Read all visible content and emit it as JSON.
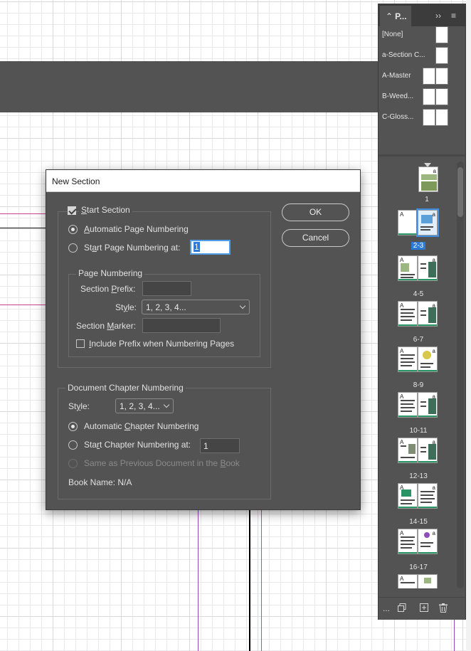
{
  "dialog": {
    "title": "New Section",
    "start_section": {
      "label_pre": "",
      "label_u": "S",
      "label_post": "tart Section",
      "checked": true
    },
    "auto_page_numbering": {
      "label_pre": "",
      "label_u": "A",
      "label_post": "utomatic Page Numbering",
      "selected": true
    },
    "start_page_numbering": {
      "label_pre": "St",
      "label_u": "a",
      "label_post": "rt Page Numbering at:",
      "selected": false,
      "value": "1"
    },
    "page_numbering_group": {
      "title": "Page Numbering",
      "section_prefix_label_pre": "Section ",
      "section_prefix_label_u": "P",
      "section_prefix_label_post": "refix:",
      "section_prefix_value": "",
      "style_label_pre": "St",
      "style_label_u": "y",
      "style_label_post": "le:",
      "style_value": "1, 2, 3, 4...",
      "section_marker_label_pre": "Section ",
      "section_marker_label_u": "M",
      "section_marker_label_post": "arker:",
      "section_marker_value": "",
      "include_prefix_label_pre": "",
      "include_prefix_label_u": "I",
      "include_prefix_label_post": "nclude Prefix when Numbering Pages",
      "include_prefix_checked": false
    },
    "chapter_group": {
      "title": "Document Chapter Numbering",
      "style_label_pre": "St",
      "style_label_u": "y",
      "style_label_post": "le:",
      "style_value": "1, 2, 3, 4...",
      "auto_chapter_pre": "Automatic ",
      "auto_chapter_u": "C",
      "auto_chapter_post": "hapter Numbering",
      "auto_chapter_selected": true,
      "start_chapter_pre": "Sta",
      "start_chapter_u": "r",
      "start_chapter_post": "t Chapter Numbering at:",
      "start_chapter_value": "1",
      "same_as_prev_pre": "Same as Previous Document in the ",
      "same_as_prev_u": "B",
      "same_as_prev_post": "ook",
      "book_name": "Book Name: N/A"
    },
    "ok_label": "OK",
    "cancel_label": "Cancel"
  },
  "pages_panel": {
    "tab_label": "P...",
    "collapse_glyph": "››",
    "menu_glyph": "≡",
    "tab_glyph": "⌃",
    "masters": [
      {
        "name": "[None]"
      },
      {
        "name": "a-Section C..."
      },
      {
        "name": "A-Master"
      },
      {
        "name": "B-Weed..."
      },
      {
        "name": "C-Gloss..."
      }
    ],
    "spreads": [
      {
        "label": "1",
        "selected": false
      },
      {
        "label": "2-3",
        "selected": true
      },
      {
        "label": "4-5",
        "selected": false
      },
      {
        "label": "6-7",
        "selected": false
      },
      {
        "label": "8-9",
        "selected": false
      },
      {
        "label": "10-11",
        "selected": false
      },
      {
        "label": "12-13",
        "selected": false
      },
      {
        "label": "14-15",
        "selected": false
      },
      {
        "label": "16-17",
        "selected": false
      }
    ],
    "page_prefix_letters": {
      "left": "A",
      "right": "a"
    },
    "footer_more": "...",
    "colors": {
      "accent": "#2d7bd8",
      "panel_bg": "#535353",
      "dialog_bg": "#535353"
    }
  }
}
